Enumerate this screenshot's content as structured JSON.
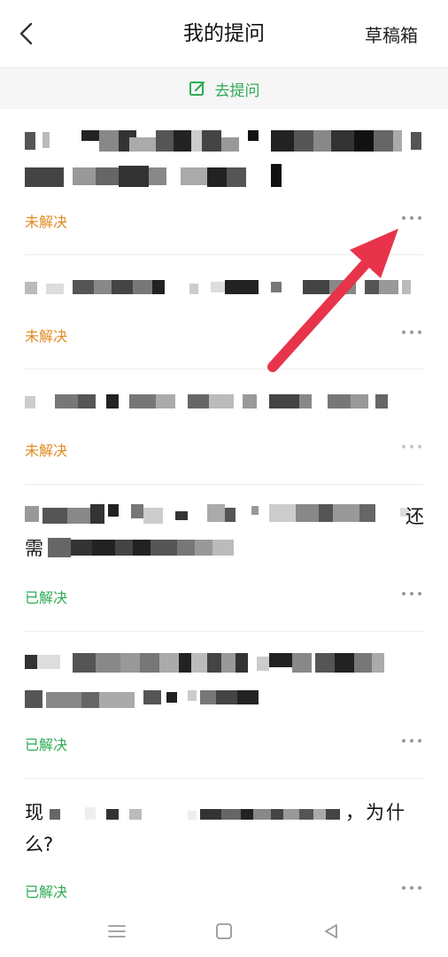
{
  "header": {
    "title": "我的提问",
    "draft_label": "草稿箱"
  },
  "ask_bar": {
    "label": "去提问"
  },
  "questions": [
    {
      "text_tail": "",
      "status": "未解决"
    },
    {
      "text_tail": "",
      "status": "未解决"
    },
    {
      "text_tail": "",
      "status": "未解决"
    },
    {
      "text_tail": "",
      "status": "已解决"
    },
    {
      "text_tail": "",
      "status": "已解决"
    },
    {
      "text_lead": "现",
      "text_tail": "，为什",
      "text_line2": "么?",
      "status": "已解决"
    }
  ],
  "colors": {
    "accent_green": "#2eab54",
    "unresolved_orange": "#e08a1e",
    "annotation_arrow": "#e8344a"
  }
}
